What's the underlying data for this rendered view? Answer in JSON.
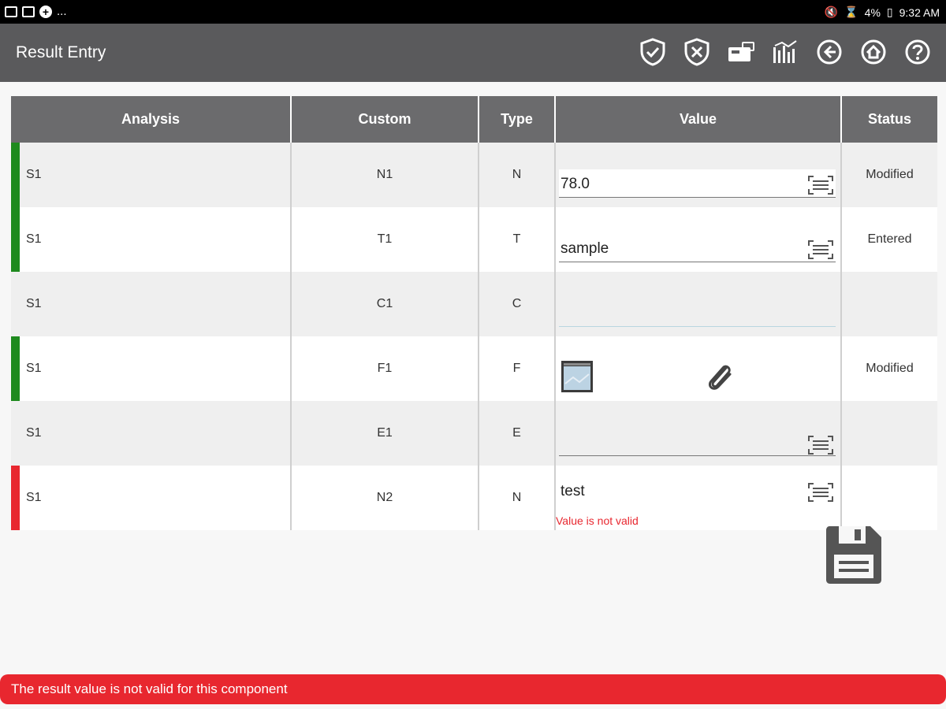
{
  "status_bar": {
    "dots": "...",
    "battery": "4%",
    "time": "9:32 AM"
  },
  "app_bar": {
    "title": "Result Entry",
    "actions": [
      "shield-check-icon",
      "shield-x-icon",
      "card-reader-icon",
      "chart-export-icon",
      "back-icon",
      "home-icon",
      "help-icon"
    ]
  },
  "table": {
    "headers": [
      "Analysis",
      "Custom",
      "Type",
      "Value",
      "Status"
    ],
    "rows": [
      {
        "analysis": "S1",
        "custom": "N1",
        "type": "N",
        "value": "78.0",
        "status": "Modified",
        "indicator": "#1e8a1e"
      },
      {
        "analysis": "S1",
        "custom": "T1",
        "type": "T",
        "value": "sample",
        "status": "Entered",
        "indicator": "#1e8a1e"
      },
      {
        "analysis": "S1",
        "custom": "C1",
        "type": "C",
        "value": "",
        "status": "",
        "indicator": ""
      },
      {
        "analysis": "S1",
        "custom": "F1",
        "type": "F",
        "value": "",
        "status": "Modified",
        "indicator": "#1e8a1e"
      },
      {
        "analysis": "S1",
        "custom": "E1",
        "type": "E",
        "value": "",
        "status": "",
        "indicator": ""
      },
      {
        "analysis": "S1",
        "custom": "N2",
        "type": "N",
        "value": "test",
        "status": "",
        "indicator": "#e8272f",
        "error": "Value is not valid"
      }
    ]
  },
  "toast": {
    "message": "The result value is not valid for this component",
    "color": "#e8272f"
  }
}
